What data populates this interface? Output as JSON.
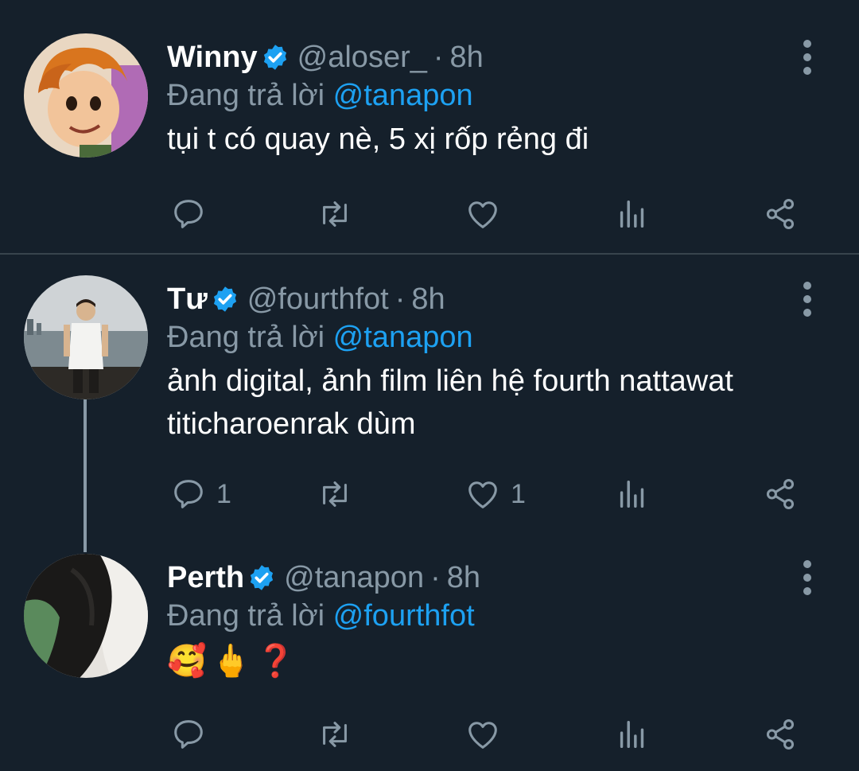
{
  "tweets": [
    {
      "name": "Winny",
      "handle": "@aloser_",
      "separator": "·",
      "time": "8h",
      "reply_prefix": "Đang trả lời",
      "reply_to": "@tanapon",
      "text": "tụi t có quay nè, 5 xị rốp rẻng đi",
      "reply_count": "",
      "like_count": ""
    },
    {
      "name": "Tư",
      "handle": "@fourthfot",
      "separator": "·",
      "time": "8h",
      "reply_prefix": "Đang trả lời",
      "reply_to": "@tanapon",
      "text": "ảnh digital, ảnh film liên hệ fourth nattawat titicharoenrak dùm",
      "reply_count": "1",
      "like_count": "1"
    },
    {
      "name": "Perth",
      "handle": "@tanapon",
      "separator": "·",
      "time": "8h",
      "reply_prefix": "Đang trả lời",
      "reply_to": "@fourthfot",
      "emojis": [
        "🥰",
        "🖕",
        "❓"
      ],
      "reply_count": "",
      "like_count": ""
    }
  ],
  "icons": {
    "verified": "verified-badge-icon",
    "more": "more-vertical-icon",
    "reply": "reply-icon",
    "retweet": "retweet-icon",
    "like": "heart-icon",
    "analytics": "analytics-icon",
    "share": "share-icon"
  },
  "colors": {
    "background": "#15202b",
    "secondary_text": "#8899a6",
    "accent": "#1da1f2",
    "divider": "#38444d"
  }
}
